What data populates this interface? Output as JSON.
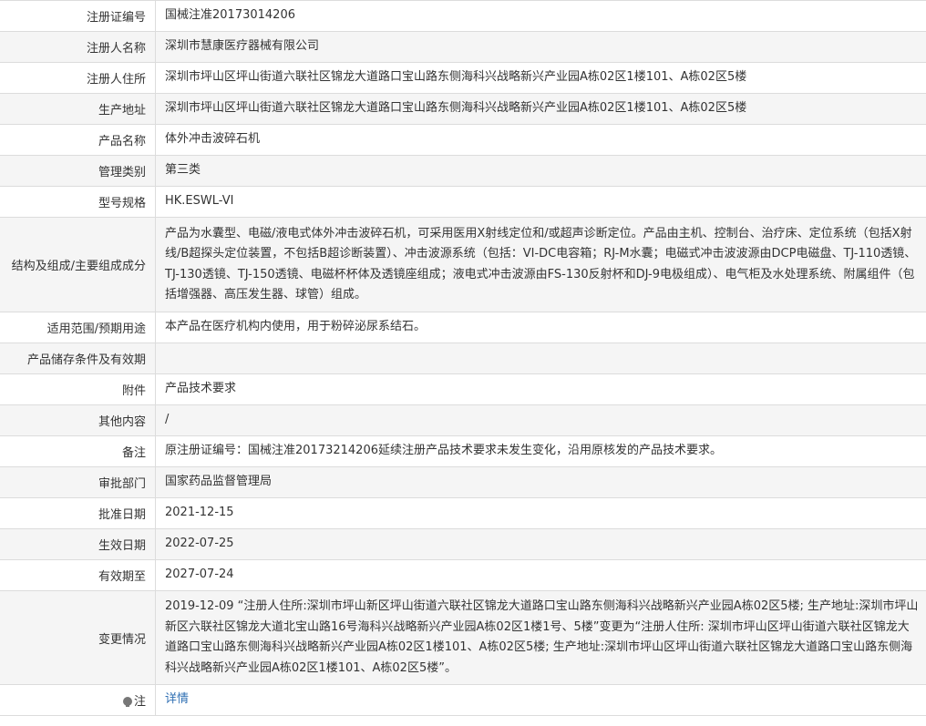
{
  "rows": [
    {
      "label": "注册证编号",
      "value": "国械注准20173014206"
    },
    {
      "label": "注册人名称",
      "value": "深圳市慧康医疗器械有限公司"
    },
    {
      "label": "注册人住所",
      "value": "深圳市坪山区坪山街道六联社区锦龙大道路口宝山路东侧海科兴战略新兴产业园A栋02区1楼101、A栋02区5楼"
    },
    {
      "label": "生产地址",
      "value": "深圳市坪山区坪山街道六联社区锦龙大道路口宝山路东侧海科兴战略新兴产业园A栋02区1楼101、A栋02区5楼"
    },
    {
      "label": "产品名称",
      "value": "体外冲击波碎石机"
    },
    {
      "label": "管理类别",
      "value": "第三类"
    },
    {
      "label": "型号规格",
      "value": "HK.ESWL-VI"
    },
    {
      "label": "结构及组成/主要组成成分",
      "value": "产品为水囊型、电磁/液电式体外冲击波碎石机，可采用医用X射线定位和/或超声诊断定位。产品由主机、控制台、治疗床、定位系统（包括X射线/B超探头定位装置，不包括B超诊断装置）、冲击波源系统（包括：VI-DC电容箱；RJ-M水囊；电磁式冲击波波源由DCP电磁盘、TJ-110透镜、TJ-130透镜、TJ-150透镜、电磁杯杯体及透镜座组成；液电式冲击波源由FS-130反射杯和DJ-9电极组成）、电气柜及水处理系统、附属组件（包括增强器、高压发生器、球管）组成。"
    },
    {
      "label": "适用范围/预期用途",
      "value": "本产品在医疗机构内使用，用于粉碎泌尿系结石。"
    },
    {
      "label": "产品储存条件及有效期",
      "value": ""
    },
    {
      "label": "附件",
      "value": "产品技术要求"
    },
    {
      "label": "其他内容",
      "value": "/"
    },
    {
      "label": "备注",
      "value": "原注册证编号：国械注准20173214206延续注册产品技术要求未发生变化，沿用原核发的产品技术要求。"
    },
    {
      "label": "审批部门",
      "value": "国家药品监督管理局"
    },
    {
      "label": "批准日期",
      "value": "2021-12-15"
    },
    {
      "label": "生效日期",
      "value": "2022-07-25"
    },
    {
      "label": "有效期至",
      "value": "2027-07-24"
    },
    {
      "label": "变更情况",
      "value": "2019-12-09 “注册人住所:深圳市坪山新区坪山街道六联社区锦龙大道路口宝山路东侧海科兴战略新兴产业园A栋02区5楼; 生产地址:深圳市坪山新区六联社区锦龙大道北宝山路16号海科兴战略新兴产业园A栋02区1楼1号、5楼”变更为“注册人住所: 深圳市坪山区坪山街道六联社区锦龙大道路口宝山路东侧海科兴战略新兴产业园A栋02区1楼101、A栋02区5楼; 生产地址:深圳市坪山区坪山街道六联社区锦龙大道路口宝山路东侧海科兴战略新兴产业园A栋02区1楼101、A栋02区5楼”。"
    }
  ],
  "note": {
    "label": "注",
    "icon": "lightbulb-icon",
    "link_text": "详情"
  }
}
